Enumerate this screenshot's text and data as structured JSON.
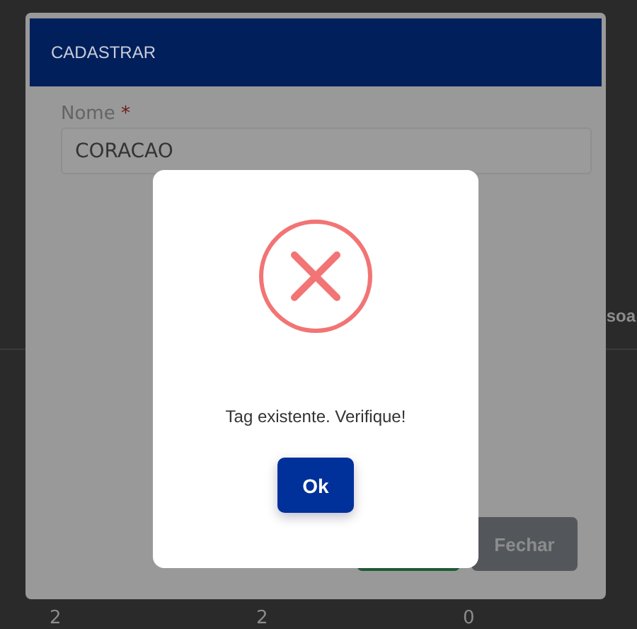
{
  "background_page": {
    "column_header": "soa",
    "row_values": [
      "2",
      "2",
      "0"
    ]
  },
  "modal": {
    "title": "CADASTRAR",
    "field": {
      "label": "Nome",
      "required_mark": "*",
      "value": "CORACAO"
    },
    "close_button": "Fechar"
  },
  "alert": {
    "kind": "error",
    "message": "Tag existente. Verifique!",
    "button": "Ok"
  }
}
